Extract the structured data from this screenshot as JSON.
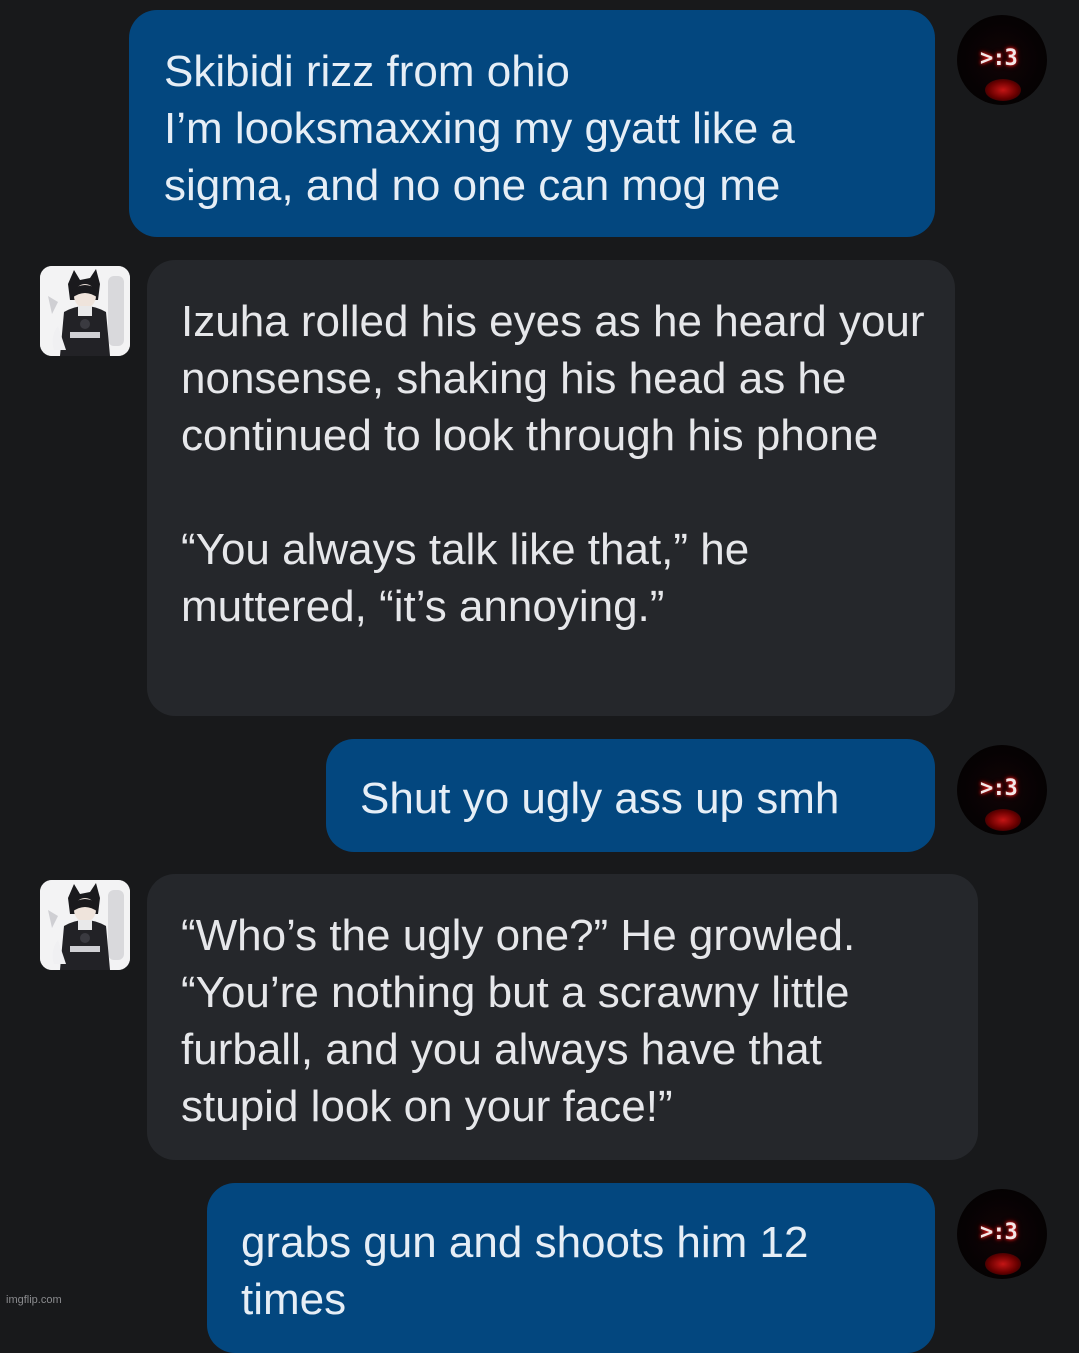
{
  "chat": {
    "messages": [
      {
        "role": "user",
        "text": "Skibidi rizz from ohio\nI’m looksmaxxing my gyatt like a sigma, and no one can mog me"
      },
      {
        "role": "bot",
        "text": "Izuha rolled his eyes as he heard your nonsense, shaking his head as he continued to look through his phone\n\n“You always talk like that,” he muttered, “it’s annoying.”"
      },
      {
        "role": "user",
        "text": "Shut yo ugly ass up smh"
      },
      {
        "role": "bot",
        "text": "“Who’s the ugly one?” He growled. “You’re nothing but a scrawny little furball, and you always have that stupid look on your face!”"
      },
      {
        "role": "user",
        "text": "grabs gun and shoots him 12 times"
      }
    ]
  },
  "avatars": {
    "user_face": ">:3",
    "user_icon": "user-avatar-icon",
    "bot_icon": "character-avatar-icon"
  },
  "watermark": "imgflip.com",
  "colors": {
    "background": "#18191b",
    "user_bubble": "#03477f",
    "bot_bubble": "#25272b",
    "text": "#e6e7ea"
  }
}
